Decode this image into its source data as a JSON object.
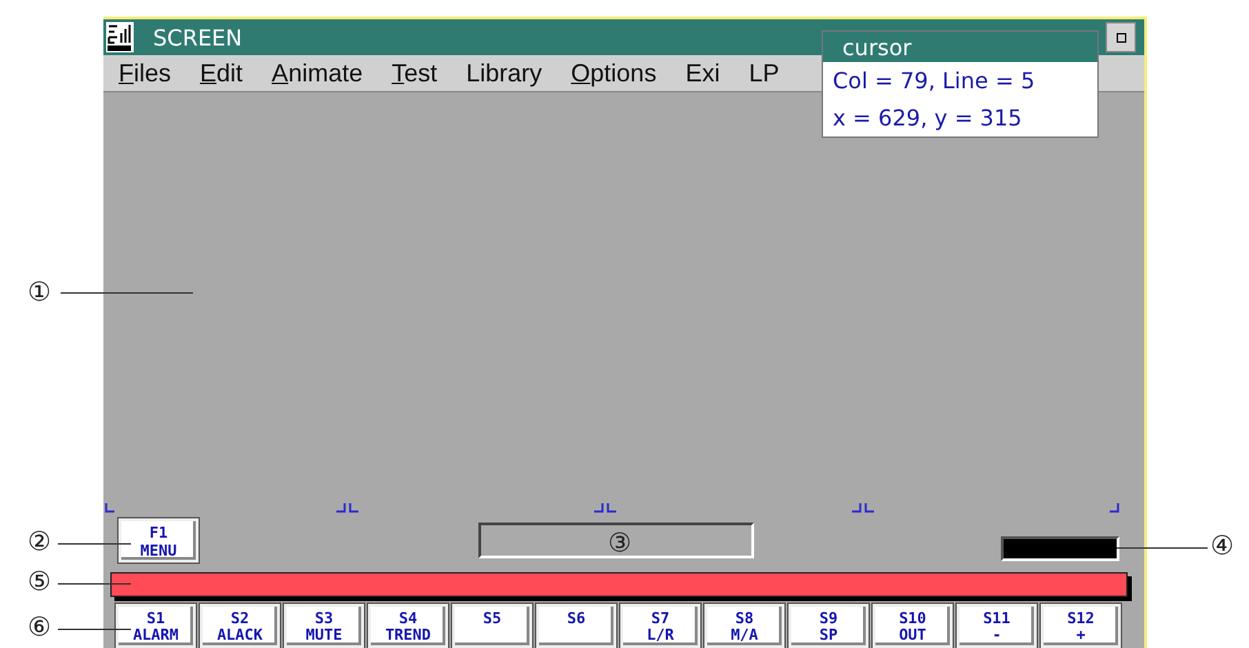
{
  "window": {
    "title": "SCREEN"
  },
  "menu": [
    {
      "label": "Files",
      "underlined": true
    },
    {
      "label": "Edit",
      "underlined": true
    },
    {
      "label": "Animate",
      "underlined": true
    },
    {
      "label": "Test",
      "underlined": true
    },
    {
      "label": "Library",
      "underlined": false
    },
    {
      "label": "Options",
      "underlined": true
    },
    {
      "label": "Exi",
      "underlined": false
    },
    {
      "label": "LP",
      "underlined": false
    }
  ],
  "cursor_popup": {
    "title": "cursor",
    "lines": [
      "Col = 79, Line = 5",
      "x = 629, y = 315"
    ]
  },
  "f1_key": {
    "key": "F1",
    "label": "MENU"
  },
  "softkeys": [
    {
      "key": "S1",
      "label": "ALARM"
    },
    {
      "key": "S2",
      "label": "ALACK"
    },
    {
      "key": "S3",
      "label": "MUTE"
    },
    {
      "key": "S4",
      "label": "TREND"
    },
    {
      "key": "S5"
    },
    {
      "key": "S6"
    },
    {
      "key": "S7",
      "label": "L/R"
    },
    {
      "key": "S8",
      "label": "M/A"
    },
    {
      "key": "S9",
      "label": "SP"
    },
    {
      "key": "S10",
      "label": "OUT"
    },
    {
      "key": "S11",
      "label": "-"
    },
    {
      "key": "S12",
      "label": "+"
    }
  ],
  "callouts": [
    "①",
    "②",
    "③",
    "④",
    "⑤",
    "⑥"
  ]
}
